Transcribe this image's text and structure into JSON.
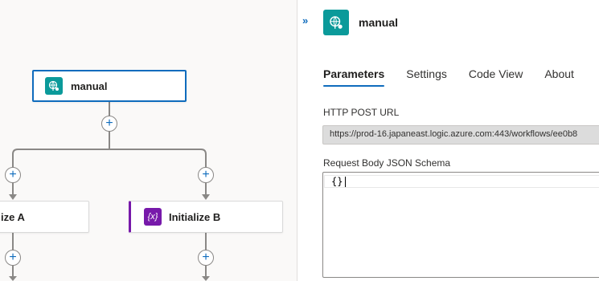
{
  "canvas": {
    "trigger": {
      "label": "manual",
      "icon": "http-request-icon",
      "color": "#0b9a9a"
    },
    "actions": [
      {
        "label": "ize A",
        "icon": "variable-icon",
        "color": "#7719aa"
      },
      {
        "label": "Initialize B",
        "icon": "variable-icon",
        "color": "#7719aa",
        "icon_text": "{x}"
      }
    ],
    "add_symbol": "+"
  },
  "panel": {
    "collapse_glyph": "»",
    "title": "manual",
    "icon": "http-request-icon",
    "tabs": [
      {
        "label": "Parameters",
        "active": true
      },
      {
        "label": "Settings",
        "active": false
      },
      {
        "label": "Code View",
        "active": false
      },
      {
        "label": "About",
        "active": false
      }
    ],
    "http_post_url": {
      "label": "HTTP POST URL",
      "value": "https://prod-16.japaneast.logic.azure.com:443/workflows/ee0b8"
    },
    "schema": {
      "label": "Request Body JSON Schema",
      "value": "{}"
    }
  },
  "colors": {
    "accent": "#0f6cbd",
    "trigger_teal": "#0b9a9a",
    "variable_purple": "#7719aa"
  }
}
